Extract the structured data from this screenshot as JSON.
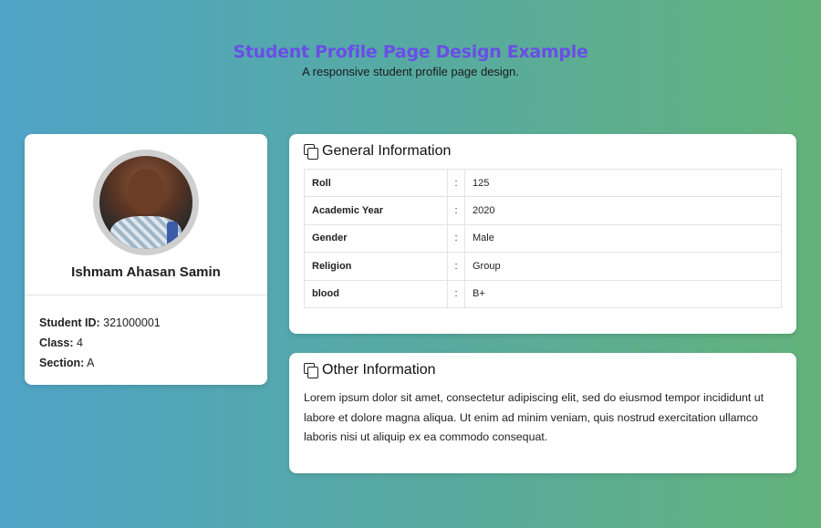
{
  "header": {
    "title": "Student Profile Page Design Example",
    "subtitle": "A responsive student profile page design."
  },
  "profile": {
    "name": "Ishmam Ahasan Samin",
    "fields": [
      {
        "label": "Student ID:",
        "value": "321000001"
      },
      {
        "label": "Class:",
        "value": "4"
      },
      {
        "label": "Section:",
        "value": "A"
      }
    ]
  },
  "general": {
    "title": "General Information",
    "rows": [
      {
        "key": "Roll",
        "sep": ":",
        "value": "125"
      },
      {
        "key": "Academic Year",
        "sep": ":",
        "value": "2020"
      },
      {
        "key": "Gender",
        "sep": ":",
        "value": "Male"
      },
      {
        "key": "Religion",
        "sep": ":",
        "value": "Group"
      },
      {
        "key": "blood",
        "sep": ":",
        "value": "B+"
      }
    ]
  },
  "other": {
    "title": "Other Information",
    "text": "Lorem ipsum dolor sit amet, consectetur adipiscing elit, sed do eiusmod tempor incididunt ut labore et dolore magna aliqua. Ut enim ad minim veniam, quis nostrud exercitation ullamco laboris nisi ut aliquip ex ea commodo consequat."
  },
  "icons": {
    "section_icon": "copy-icon"
  },
  "colors": {
    "title": "#6a4ee6",
    "bg_left": "#4fa3c6",
    "bg_right": "#63b27a"
  }
}
